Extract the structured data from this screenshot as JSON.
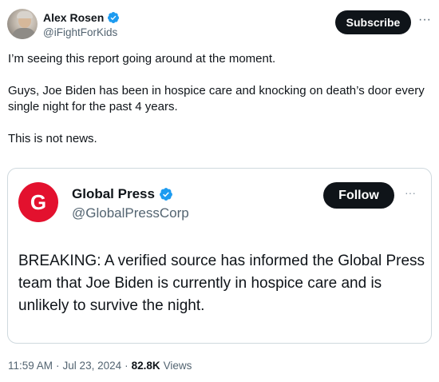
{
  "author": {
    "name": "Alex Rosen",
    "handle": "@iFightForKids",
    "verified_color": "#1d9bf0"
  },
  "actions": {
    "subscribe_label": "Subscribe",
    "more_label": "···"
  },
  "tweet": {
    "paragraphs": [
      "I’m seeing this report going around at the moment.",
      "Guys, Joe Biden has been in hospice care and knocking on death’s door every single night for the past 4 years.",
      "This is not news."
    ]
  },
  "quote": {
    "logo_letter": "G",
    "logo_color": "#e3112e",
    "name": "Global Press",
    "handle": "@GlobalPressCorp",
    "follow_label": "Follow",
    "more_label": "···",
    "text": "BREAKING: A verified source has informed the Global Press team that Joe Biden is currently in hospice care and is unlikely to survive the night."
  },
  "meta": {
    "time": "11:59 AM",
    "separator": "·",
    "date": "Jul 23, 2024",
    "separator2": "·",
    "views_count": "82.8K",
    "views_label": "Views"
  }
}
